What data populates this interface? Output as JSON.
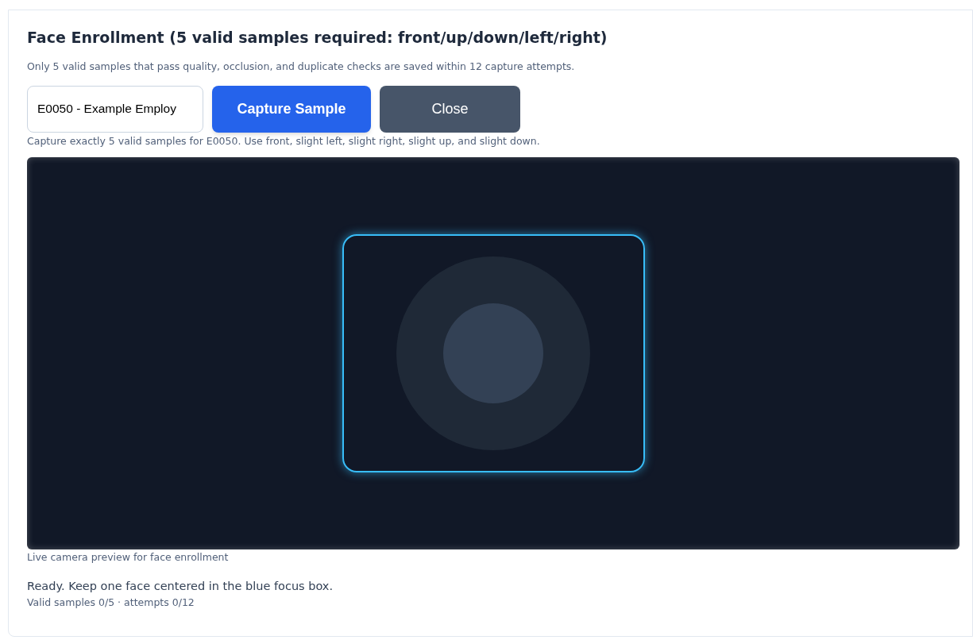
{
  "dialog": {
    "title": "Face Enrollment (5 valid samples required: front/up/down/left/right)",
    "description": "Only 5 valid samples that pass quality, occlusion, and duplicate checks are saved within 12 capture attempts.",
    "employee_field": {
      "value": "E0050 - Example Employ"
    },
    "buttons": [
      {
        "label": "Capture Sample",
        "kind": "primary"
      },
      {
        "label": "Close",
        "kind": "secondary"
      }
    ],
    "hint": "Capture exactly 5 valid samples for E0050. Use front, slight left, slight right, slight up, and slight down.",
    "preview_caption": "Live camera preview for face enrollment",
    "status": "Ready. Keep one face centered in the blue focus box.",
    "counter": "Valid samples 0/5 · attempts 0/12"
  }
}
